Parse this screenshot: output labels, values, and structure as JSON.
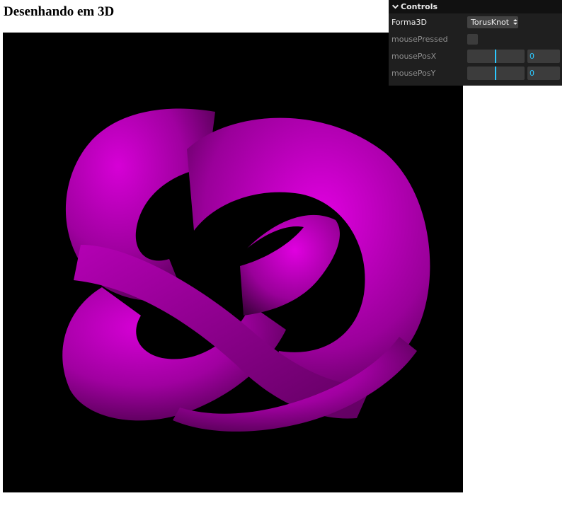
{
  "page": {
    "title": "Desenhando em 3D"
  },
  "scene": {
    "shape": "TorusKnot",
    "background": "#000000",
    "object_color": "#c000c0"
  },
  "gui": {
    "title": "Controls",
    "controls": [
      {
        "label": "Forma3D",
        "type": "select",
        "value": "TorusKnot"
      },
      {
        "label": "mousePressed",
        "type": "checkbox",
        "checked": false
      },
      {
        "label": "mousePosX",
        "type": "slider",
        "value": "0"
      },
      {
        "label": "mousePosY",
        "type": "slider",
        "value": "0"
      }
    ],
    "colors": {
      "panel": "#1f1f1f",
      "title_bar": "#111111",
      "accent": "#2cc9ff"
    }
  }
}
